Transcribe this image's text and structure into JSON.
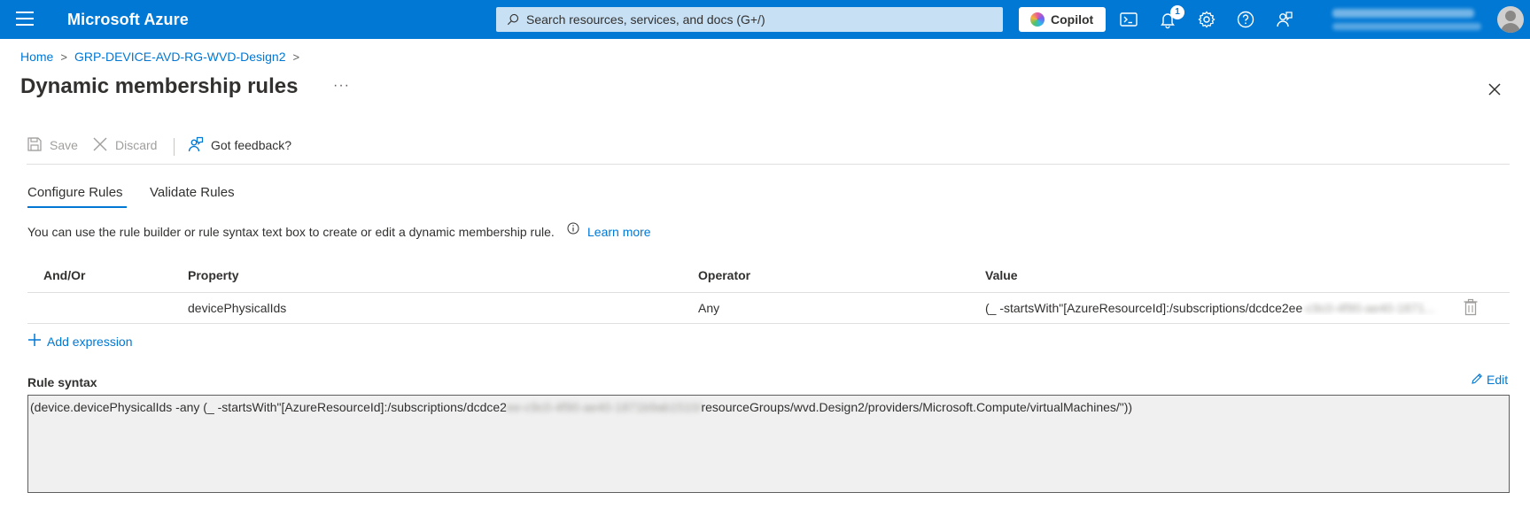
{
  "topbar": {
    "brand": "Microsoft Azure",
    "search_placeholder": "Search resources, services, and docs (G+/)",
    "copilot_label": "Copilot",
    "notification_count": "1"
  },
  "breadcrumb": {
    "home": "Home",
    "group": "GRP-DEVICE-AVD-RG-WVD-Design2"
  },
  "page": {
    "title": "Dynamic membership rules",
    "more": "···"
  },
  "toolbar": {
    "save_label": "Save",
    "discard_label": "Discard",
    "feedback_label": "Got feedback?"
  },
  "tabs": {
    "configure": "Configure Rules",
    "validate": "Validate Rules"
  },
  "info": {
    "text": "You can use the rule builder or rule syntax text box to create or edit a dynamic membership rule.",
    "learn_more": "Learn more"
  },
  "table": {
    "headers": {
      "andor": "And/Or",
      "property": "Property",
      "operator": "Operator",
      "value": "Value"
    },
    "rows": [
      {
        "andor": "",
        "property": "devicePhysicalIds",
        "operator": "Any",
        "value_visible": "(_ -startsWith\"[AzureResourceId]:/subscriptions/dcdce2ee",
        "value_blurred": "-c9c0-4f90-ae40-1871..."
      }
    ]
  },
  "add_expression": "Add expression",
  "rule_syntax": {
    "label": "Rule syntax",
    "edit_label": "Edit",
    "text_start": "(device.devicePhysicalIds -any (_ -startsWith\"[AzureResourceId]:/subscriptions/dcdce2",
    "text_blurred": "ee-c9c0-4f90-ae40-1871b9ab1510/",
    "text_end": "resourceGroups/wvd.Design2/providers/Microsoft.Compute/virtualMachines/\"))"
  },
  "colors": {
    "accent": "#0078d4",
    "text": "#323130",
    "disabled": "#a19f9d"
  }
}
